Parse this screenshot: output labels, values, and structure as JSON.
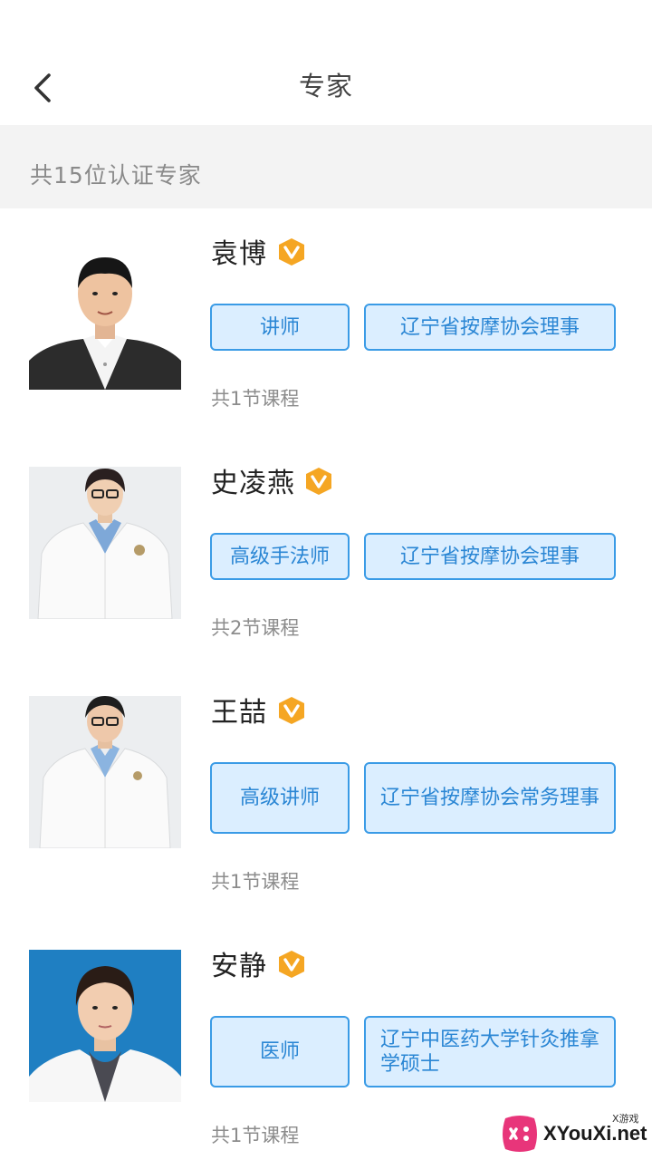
{
  "header": {
    "title": "专家",
    "back_icon": "chevron-left-icon"
  },
  "summary": {
    "count_text": "共15位认证专家"
  },
  "colors": {
    "tag_border": "#3a9be6",
    "tag_bg": "#dbeeff",
    "tag_text": "#2a86d4",
    "badge": "#f5a623"
  },
  "experts": [
    {
      "name": "袁博",
      "badge_icon": "vip-badge-icon",
      "tags": [
        "讲师",
        "辽宁省按摩协会理事"
      ],
      "courses": "共1节课程"
    },
    {
      "name": "史凌燕",
      "badge_icon": "vip-badge-icon",
      "tags": [
        "高级手法师",
        "辽宁省按摩协会理事"
      ],
      "courses": "共2节课程"
    },
    {
      "name": "王喆",
      "badge_icon": "vip-badge-icon",
      "tags": [
        "高级讲师",
        "辽宁省按摩协会常务理事"
      ],
      "courses": "共1节课程"
    },
    {
      "name": "安静",
      "badge_icon": "vip-badge-icon",
      "tags": [
        "医师",
        "辽宁中医药大学针灸推拿学硕士"
      ],
      "courses": "共1节课程"
    }
  ],
  "watermark": {
    "text": "XYouXi.net",
    "small_text": "X游戏"
  }
}
